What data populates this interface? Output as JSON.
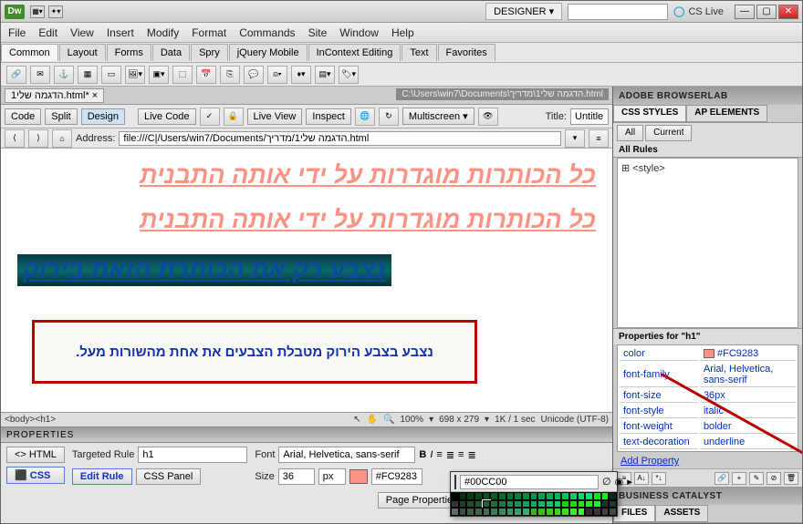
{
  "titlebar": {
    "logo": "Dw",
    "designer": "DESIGNER ▾",
    "cslive": "CS Live"
  },
  "menubar": [
    "File",
    "Edit",
    "View",
    "Insert",
    "Modify",
    "Format",
    "Commands",
    "Site",
    "Window",
    "Help"
  ],
  "insert_tabs": [
    "Common",
    "Layout",
    "Forms",
    "Data",
    "Spry",
    "jQuery Mobile",
    "InContext Editing",
    "Text",
    "Favorites"
  ],
  "doc": {
    "tab": "הדגמה שלי1.html*",
    "path": "C:\\Users\\win7\\Documents\\הדגמה שלי1\\מדריך.html",
    "views": {
      "code": "Code",
      "split": "Split",
      "design": "Design"
    },
    "livecode": "Live Code",
    "liveview": "Live View",
    "inspect": "Inspect",
    "multiscreen": "Multiscreen ▾",
    "title_label": "Title:",
    "title_value": "Untitle",
    "addr_label": "Address:",
    "addr_value": "file:///C|/Users/win7/Documents/הדגמה שלי1/מדריך.html"
  },
  "canvas": {
    "h1a": "כל הכותרות מוגדרות על ידי אותה התבנית",
    "h1b": "כל הכותרות מוגדרות על ידי אותה התבנית",
    "h1c": "נצבע רק את הכותרת הזאת בירוק",
    "annotation": "נצבע בצבע הירוק מטבלת הצבעים את אחת מהשורות מעל."
  },
  "status": {
    "tag": "<body><h1>",
    "dims": "698 x 279",
    "zoom": "100%",
    "dl": "1K / 1 sec",
    "enc": "Unicode (UTF-8)"
  },
  "properties": {
    "header": "PROPERTIES",
    "html": "<> HTML",
    "css": "CSS",
    "targeted_rule_label": "Targeted Rule",
    "targeted_rule": "h1",
    "edit_rule": "Edit Rule",
    "css_panel": "CSS Panel",
    "font_label": "Font",
    "font_value": "Arial, Helvetica, sans-serif",
    "size_label": "Size",
    "size_value": "36",
    "size_unit": "px",
    "color_hex": "#FC9283",
    "page_props": "Page Properties…"
  },
  "colorpicker": {
    "hex": "#00CC00",
    "swatch": "#00cc00"
  },
  "panels": {
    "browserlab": "ADOBE BROWSERLAB",
    "css_styles": "CSS STYLES",
    "ap_elements": "AP ELEMENTS",
    "all": "All",
    "current": "Current",
    "all_rules": "All Rules",
    "style_entry": "<style>",
    "props_for": "Properties for \"h1\"",
    "rows": [
      {
        "k": "color",
        "v": "#FC9283",
        "sw": "#FC9283"
      },
      {
        "k": "font-family",
        "v": "Arial, Helvetica, sans-serif"
      },
      {
        "k": "font-size",
        "v": "36px"
      },
      {
        "k": "font-style",
        "v": "italic"
      },
      {
        "k": "font-weight",
        "v": "bolder"
      },
      {
        "k": "text-decoration",
        "v": "underline"
      }
    ],
    "add_property": "Add Property",
    "business_catalyst": "BUSINESS CATALYST",
    "files": "FILES",
    "assets": "ASSETS"
  }
}
